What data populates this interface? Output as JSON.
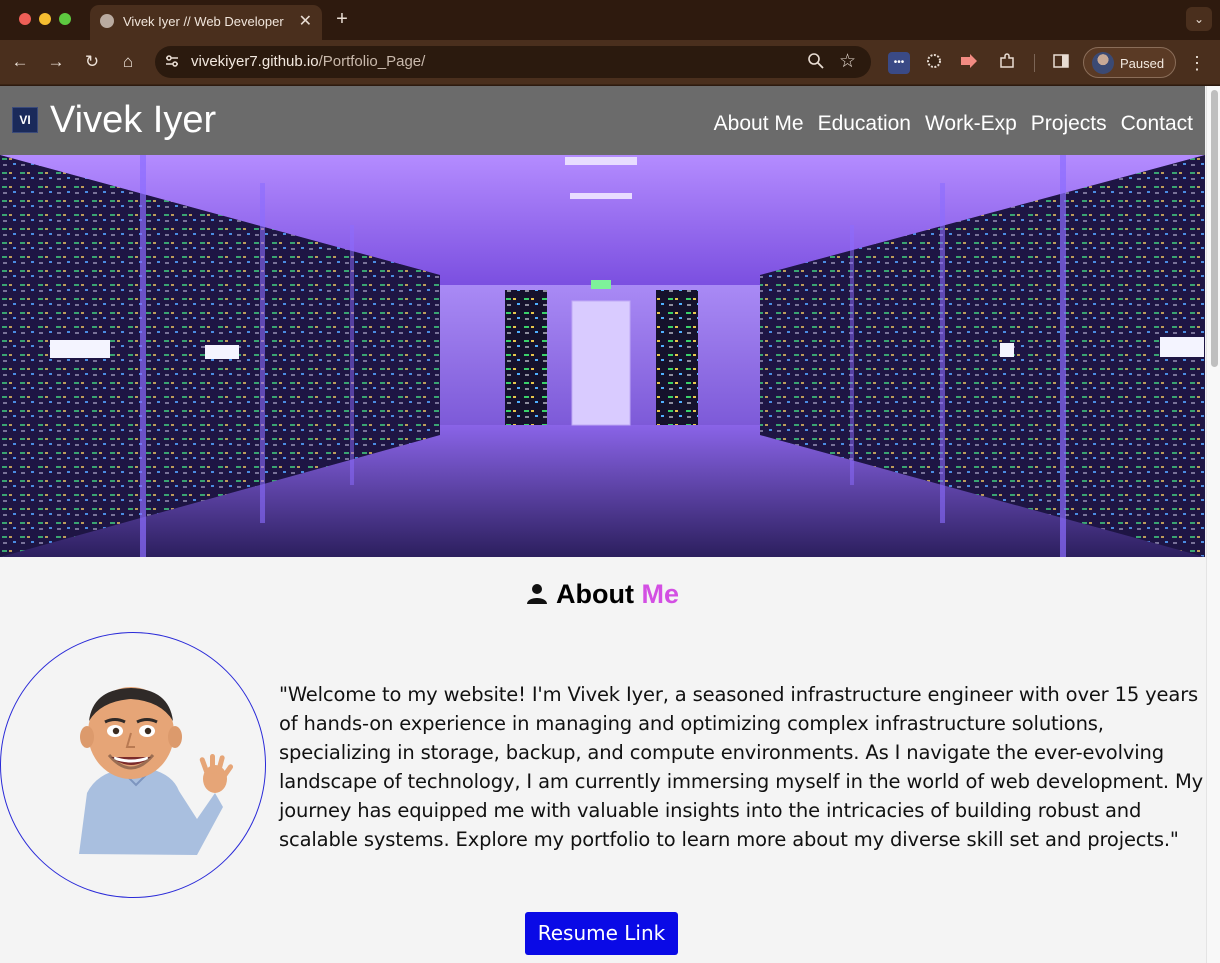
{
  "browser": {
    "tab_title": "Vivek Iyer // Web Developer",
    "tab_close": "✕",
    "new_tab": "+",
    "url_host": "vivekiyer7.github.io",
    "url_path": "/Portfolio_Page/",
    "profile_label": "Paused",
    "icons": {
      "back": "←",
      "forward": "→",
      "reload": "↻",
      "home": "⌂",
      "zoom": "⚲",
      "star": "☆",
      "menu": "⋮",
      "tablist": "⌄"
    }
  },
  "site": {
    "logo_text": "VI",
    "title": "Vivek Iyer",
    "nav": [
      "About Me",
      "Education",
      "Work-Exp",
      "Projects",
      "Contact"
    ]
  },
  "about": {
    "heading_main": "About",
    "heading_accent": "Me",
    "bio": "\"Welcome to my website! I'm Vivek Iyer, a seasoned infrastructure engineer with over 15 years of hands-on experience in managing and optimizing complex infrastructure solutions, specializing in storage, backup, and compute environments. As I navigate the ever-evolving landscape of technology, I am currently immersing myself in the world of web development. My journey has equipped me with valuable insights into the intricacies of building robust and scalable systems. Explore my portfolio to learn more about my diverse skill set and projects.\"",
    "resume_button": "Resume Link"
  },
  "colors": {
    "accent": "#d34fe3",
    "button": "#0a0ae6",
    "header": "#6b6b6b",
    "avatar_ring": "#2a2ad8"
  }
}
